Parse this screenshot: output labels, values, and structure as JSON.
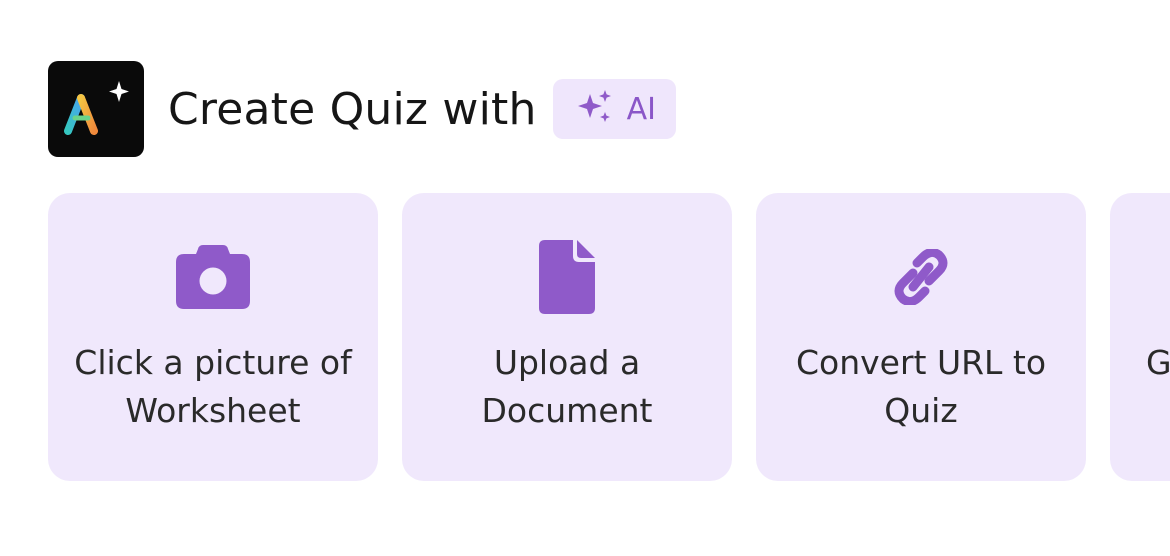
{
  "header": {
    "title": "Create Quiz with",
    "badge_label": "AI",
    "logo_icon": "ai-logo-icon",
    "badge_icon": "sparkles-icon"
  },
  "colors": {
    "accent": "#8f5ac9",
    "card_bg": "#f0e8fc",
    "badge_bg": "#efe6fc",
    "logo_bg": "#0a0a0a"
  },
  "options": [
    {
      "label": "Click a picture of Worksheet",
      "icon": "camera-icon"
    },
    {
      "label": "Upload a Document",
      "icon": "document-icon"
    },
    {
      "label": "Convert URL to Quiz",
      "icon": "link-icon"
    },
    {
      "label": "G",
      "icon": ""
    }
  ]
}
